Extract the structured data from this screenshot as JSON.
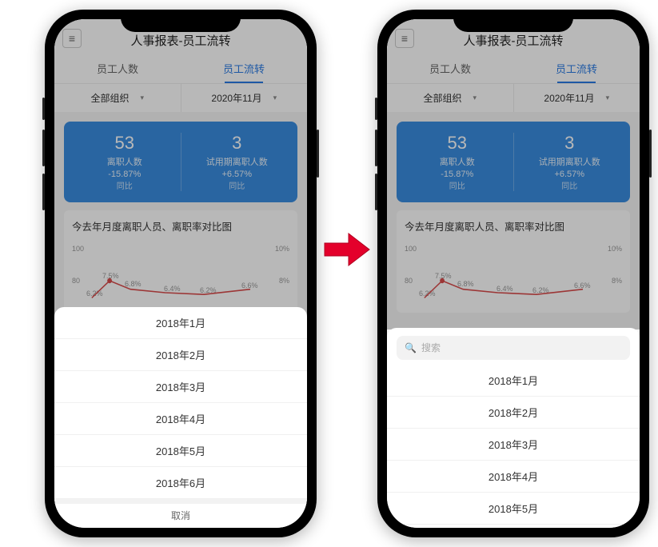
{
  "header": {
    "title": "人事报表-员工流转"
  },
  "tabs": [
    {
      "label": "员工人数",
      "active": false
    },
    {
      "label": "员工流转",
      "active": true
    }
  ],
  "filters": {
    "org": "全部组织",
    "period": "2020年11月"
  },
  "cards": [
    {
      "value": "53",
      "label": "离职人数",
      "delta": "-15.87%",
      "yoy": "同比"
    },
    {
      "value": "3",
      "label": "试用期离职人数",
      "delta": "+6.57%",
      "yoy": "同比"
    }
  ],
  "section": {
    "title": "今去年月度离职人员、离职率对比图"
  },
  "chart_data": {
    "type": "line",
    "yl_ticks": [
      "100",
      "80"
    ],
    "yr_ticks": [
      "10%",
      "8%"
    ],
    "series": [
      {
        "name": "rate",
        "points": [
          "6.2%",
          "7.5%",
          "6.8%",
          "6.4%",
          "6.2%",
          "6.6%"
        ]
      }
    ]
  },
  "sheet_left": {
    "items": [
      "2018年1月",
      "2018年2月",
      "2018年3月",
      "2018年4月",
      "2018年5月",
      "2018年6月"
    ],
    "cancel": "取消"
  },
  "sheet_right": {
    "search_placeholder": "搜索",
    "items": [
      "2018年1月",
      "2018年2月",
      "2018年3月",
      "2018年4月",
      "2018年5月"
    ]
  }
}
